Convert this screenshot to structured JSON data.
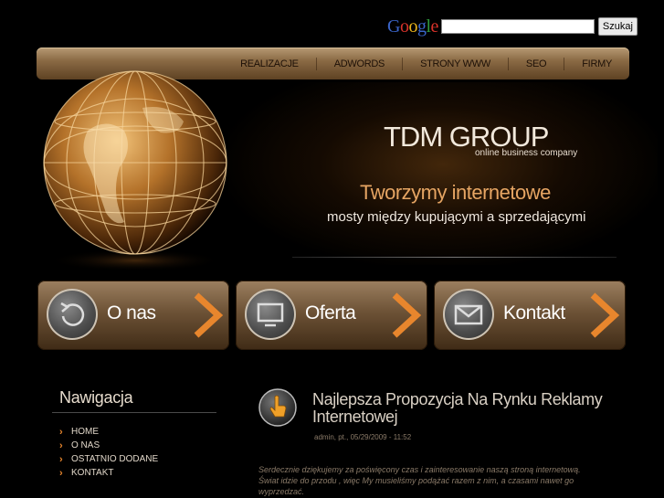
{
  "search": {
    "logo": "Google",
    "logo_letters": [
      "G",
      "o",
      "o",
      "g",
      "l",
      "e"
    ],
    "input_value": "",
    "button_label": "Szukaj"
  },
  "nav": {
    "items": [
      {
        "label": "REALIZACJE"
      },
      {
        "label": "ADWORDS"
      },
      {
        "label": "STRONY WWW"
      },
      {
        "label": "SEO"
      },
      {
        "label": "FIRMY"
      }
    ]
  },
  "brand": {
    "title": "TDM GROUP",
    "subtitle": "online business company",
    "slogan_line1": "Tworzymy internetowe",
    "slogan_line2": "mosty między kupującymi a sprzedającymi"
  },
  "features": [
    {
      "label": "O nas",
      "icon": "refresh-icon"
    },
    {
      "label": "Oferta",
      "icon": "monitor-icon"
    },
    {
      "label": "Kontakt",
      "icon": "envelope-icon"
    }
  ],
  "sidebar": {
    "heading": "Nawigacja",
    "links": [
      {
        "label": "HOME"
      },
      {
        "label": "O NAS"
      },
      {
        "label": "OSTATNIO DODANE"
      },
      {
        "label": "KONTAKT"
      }
    ]
  },
  "post": {
    "title": "Najlepsza Propozycja Na Rynku Reklamy Internetowej",
    "meta": "admin, pt., 05/29/2009 - 11:52",
    "body": "Serdecznie dziękujemy za poświęcony czas i zainteresowanie naszą stroną internetową. Świat idzie do przodu , więc My musieliśmy podążać razem z nim, a czasami nawet go wyprzedzać."
  },
  "colors": {
    "accent_orange": "#e8862d",
    "slogan": "#e6a563",
    "navbar": "#8b6b45"
  }
}
